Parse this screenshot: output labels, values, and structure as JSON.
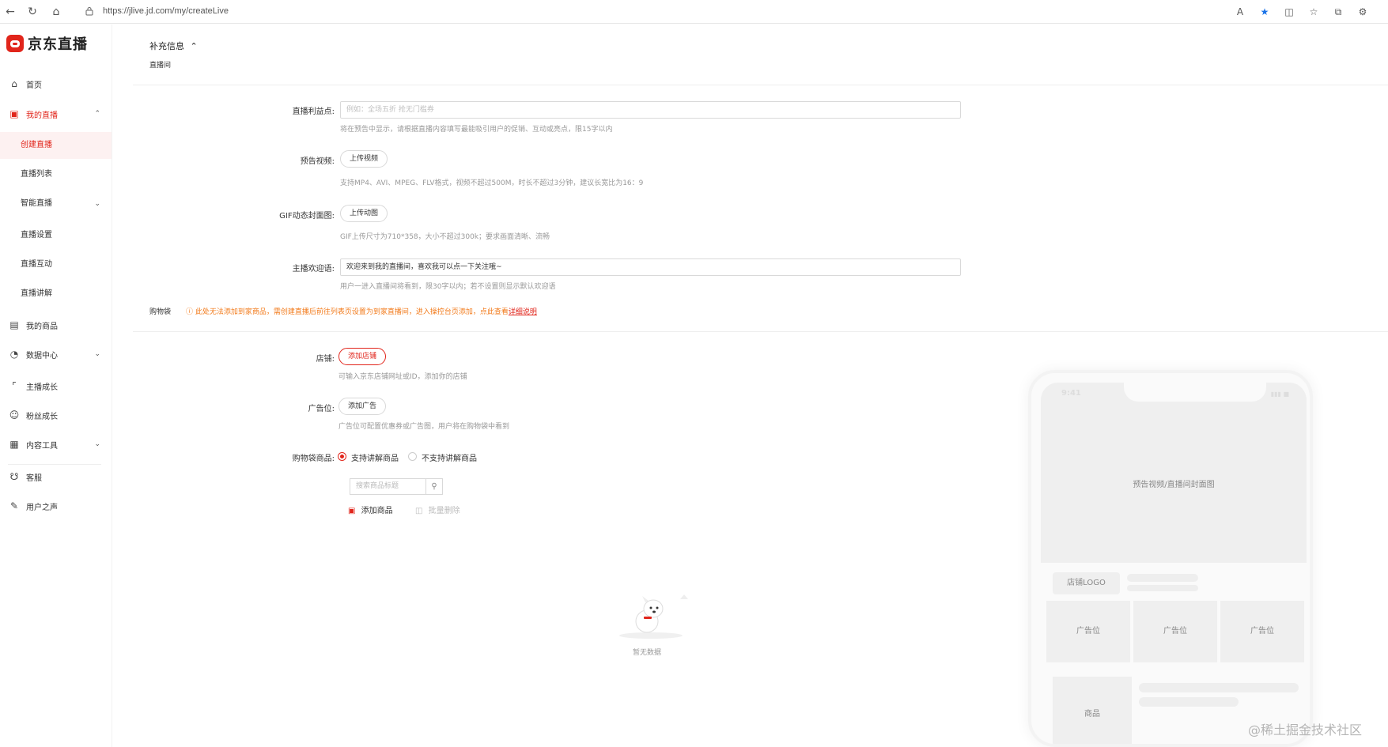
{
  "browser": {
    "url": "https://jlive.jd.com/my/createLive"
  },
  "sidebar": {
    "logo_text": "京东直播",
    "items": [
      {
        "label": "首页",
        "icon": "home-icon"
      },
      {
        "label": "我的直播",
        "icon": "video-icon"
      },
      {
        "label": "创建直播"
      },
      {
        "label": "直播列表"
      },
      {
        "label": "智能直播"
      },
      {
        "label": "直播设置"
      },
      {
        "label": "直播互动"
      },
      {
        "label": "直播讲解"
      },
      {
        "label": "我的商品",
        "icon": "bag-icon"
      },
      {
        "label": "数据中心",
        "icon": "chart-icon"
      },
      {
        "label": "主播成长",
        "icon": "growth-icon"
      },
      {
        "label": "粉丝成长",
        "icon": "fans-icon"
      },
      {
        "label": "内容工具",
        "icon": "toolbox-icon"
      },
      {
        "label": "客服",
        "icon": "headset-icon"
      },
      {
        "label": "用户之声",
        "icon": "feedback-icon"
      }
    ]
  },
  "section": {
    "title": "补充信息",
    "subtitle": "直播间"
  },
  "form": {
    "selling_point": {
      "label": "直播利益点:",
      "placeholder": "例如：全场五折 抢无门槛券",
      "hint": "将在预告中显示，请根据直播内容填写最能吸引用户的促销、互动或亮点，限15字以内"
    },
    "preview_video": {
      "label": "预告视频:",
      "button": "上传视频",
      "hint": "支持MP4、AVI、MPEG、FLV格式，视频不超过500M，时长不超过3分钟，建议长宽比为16：9"
    },
    "gif_cover": {
      "label": "GIF动态封面图:",
      "button": "上传动图",
      "hint": "GIF上传尺寸为710*358，大小不超过300k；要求画面清晰、流畅"
    },
    "welcome": {
      "label": "主播欢迎语:",
      "value": "欢迎来到我的直播间，喜欢我可以点一下关注哦~",
      "hint": "用户一进入直播间将看到，限30字以内；若不设置则显示默认欢迎语"
    },
    "cart": {
      "label": "购物袋",
      "warning": "此处无法添加到家商品，需创建直播后前往列表页设置为到家直播间，进入操控台页添加，点此查看",
      "warning_link": "详细说明"
    },
    "shop": {
      "label": "店铺:",
      "button": "添加店铺",
      "hint": "可输入京东店铺网址或ID，添加你的店铺"
    },
    "ad": {
      "label": "广告位:",
      "button": "添加广告",
      "hint": "广告位可配置优惠券或广告图，用户将在购物袋中看到"
    },
    "cart_goods": {
      "label": "购物袋商品:",
      "option_on": "支持讲解商品",
      "option_off": "不支持讲解商品",
      "search_placeholder": "搜索商品标题",
      "add_label": "添加商品",
      "delete_label": "批量删除",
      "empty_text": "暂无数据"
    }
  },
  "phone": {
    "time": "9:41",
    "cover_text": "预告视频/直播间封面图",
    "shop_logo": "店铺LOGO",
    "ad_labels": [
      "广告位",
      "广告位",
      "广告位"
    ],
    "goods_label": "商品"
  },
  "watermark": "@稀土掘金技术社区",
  "colors": {
    "brand": "#e1251b",
    "warning": "#f27a1a"
  }
}
